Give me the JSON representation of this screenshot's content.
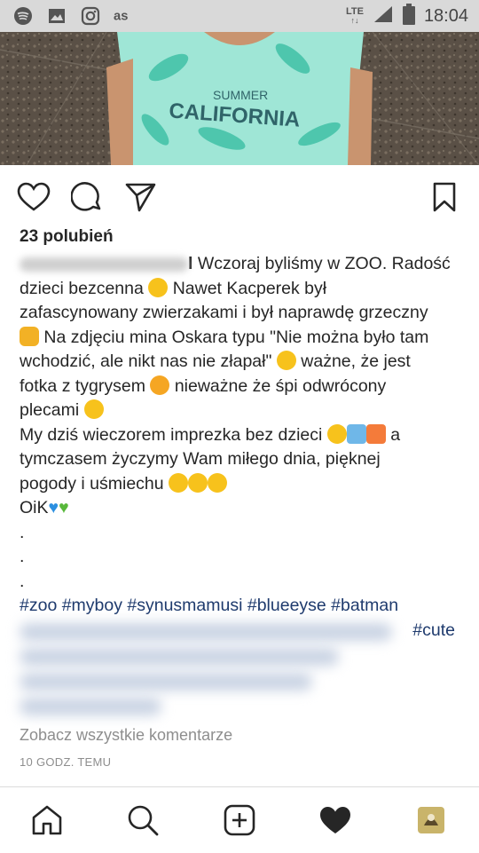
{
  "status_bar": {
    "network_label": "LTE",
    "time": "18:04",
    "icons": [
      "spotify-icon",
      "gallery-icon",
      "instagram-icon",
      "lastfm-icon",
      "signal-icon",
      "battery-icon"
    ]
  },
  "post": {
    "photo_text_1": "SUMMER",
    "photo_text_2": "CALIFORNIA",
    "likes_text": "23 polubień",
    "username_end": "l",
    "caption_lines": [
      "Wczoraj byliśmy w ZOO. Radość",
      "dzieci bezcenna",
      "Nawet Kacperek był",
      "zafascynowany zwierzakami i był naprawdę grzeczny",
      "Na zdjęciu mina Oskara typu \"Nie można było tam",
      "wchodzić, ale nikt nas nie złapał\"",
      "ważne, że jest",
      "fotka z tygrysem",
      "nieważne że śpi odwrócony",
      "plecami",
      "My dziś wieczorem imprezka bez dzieci",
      "a",
      "tymczasem życzymy Wam miłego dnia, pięknej",
      "pogody i uśmiechu",
      "OiK"
    ],
    "dots": [
      ".",
      ".",
      "."
    ],
    "hashtags_line": "#zoo #myboy #synusmamusi #blueeyse #batman",
    "hashtags_line2_end": "#cute",
    "comments_link": "Zobacz wszystkie komentarze",
    "time_ago": "10 GODZ. TEMU"
  },
  "colors": {
    "status_bar_bg": "#d9d9d9",
    "hashtag": "#1e3a6d",
    "secondary_text": "#8e8e8e",
    "icon": "#262626"
  }
}
